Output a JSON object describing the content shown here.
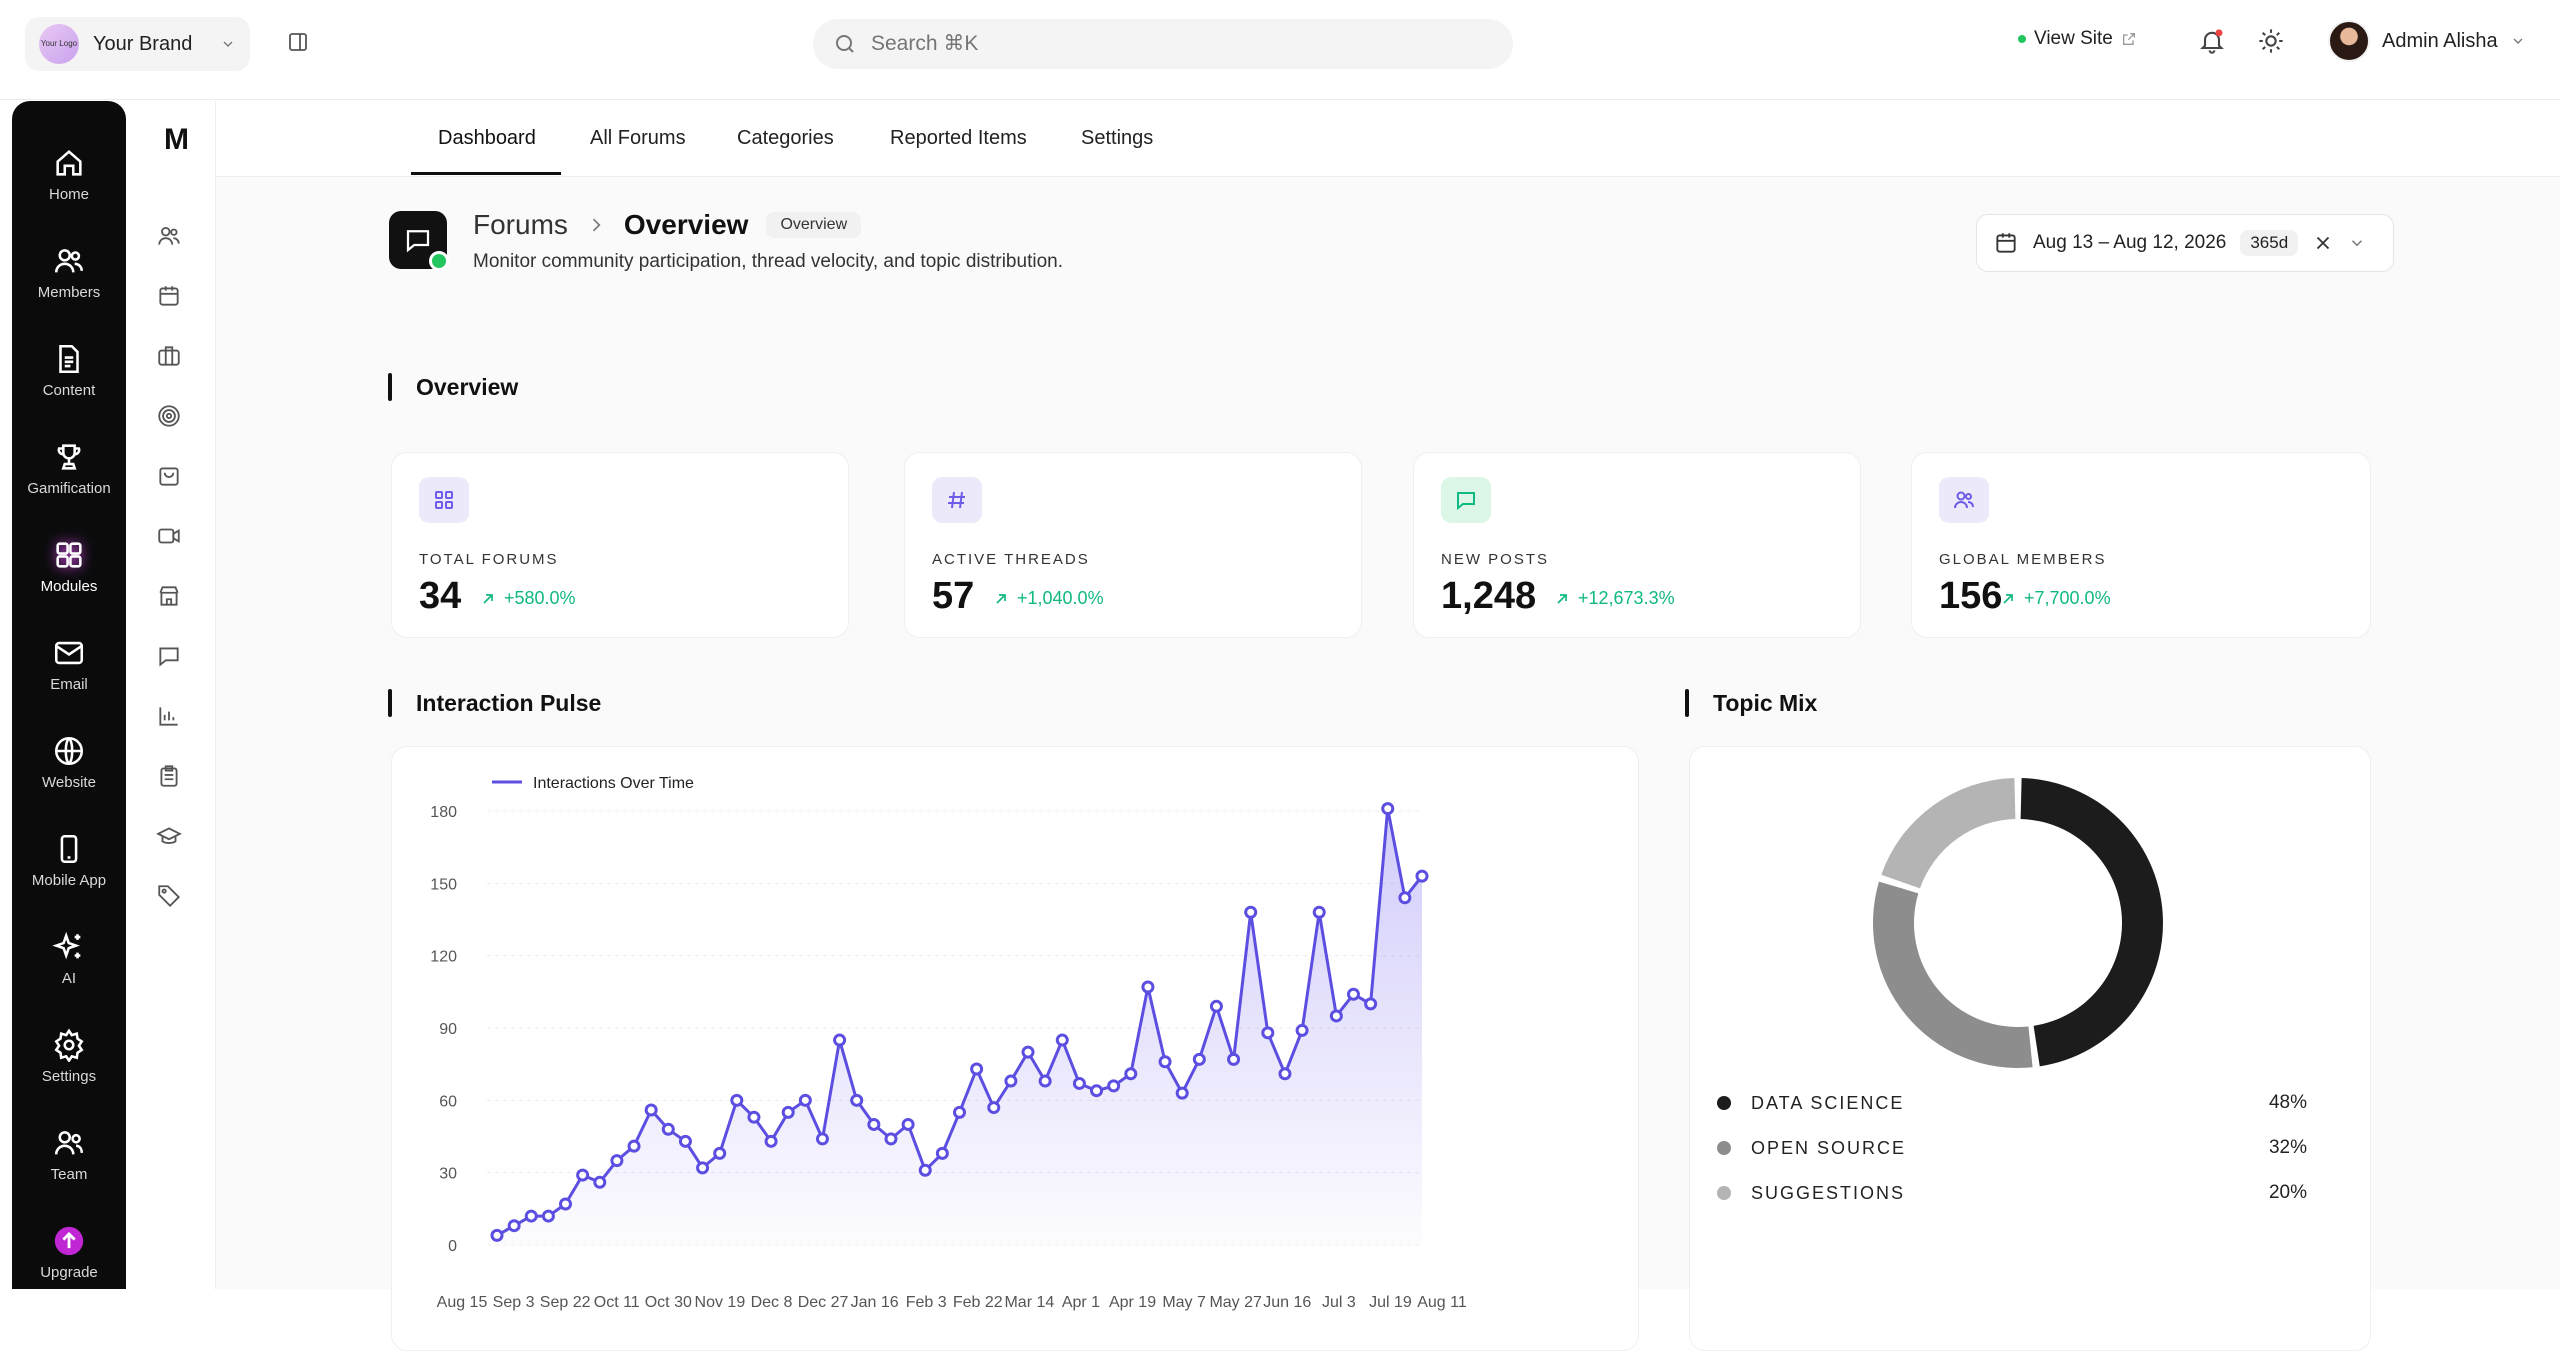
{
  "brand": {
    "logo_text": "Your Logo",
    "name": "Your Brand"
  },
  "search": {
    "placeholder": "Search ⌘K"
  },
  "header": {
    "view_site": "View Site",
    "user_name": "Admin Alisha"
  },
  "rail": [
    {
      "label": "Home",
      "icon": "home-icon"
    },
    {
      "label": "Members",
      "icon": "users-icon"
    },
    {
      "label": "Content",
      "icon": "document-icon"
    },
    {
      "label": "Gamification",
      "icon": "trophy-icon"
    },
    {
      "label": "Modules",
      "icon": "modules-icon",
      "active": true
    },
    {
      "label": "Email",
      "icon": "mail-icon"
    },
    {
      "label": "Website",
      "icon": "globe-icon"
    },
    {
      "label": "Mobile App",
      "icon": "phone-icon"
    },
    {
      "label": "AI",
      "icon": "sparkles-icon"
    },
    {
      "label": "Settings",
      "icon": "gear-icon"
    },
    {
      "label": "Team",
      "icon": "team-icon"
    },
    {
      "label": "Upgrade",
      "icon": "upgrade-icon"
    }
  ],
  "subnav": {
    "letter": "M"
  },
  "tabs": [
    {
      "label": "Dashboard",
      "active": true
    },
    {
      "label": "All Forums"
    },
    {
      "label": "Categories"
    },
    {
      "label": "Reported Items"
    },
    {
      "label": "Settings"
    }
  ],
  "page": {
    "crumb_parent": "Forums",
    "crumb_current": "Overview",
    "badge": "Overview",
    "subtitle": "Monitor community participation, thread velocity, and topic distribution."
  },
  "date_range": {
    "label": "Aug 13 – Aug 12, 2026",
    "days": "365d"
  },
  "sections": {
    "overview": "Overview",
    "pulse": "Interaction Pulse",
    "topics": "Topic Mix"
  },
  "stats": [
    {
      "label": "TOTAL FORUMS",
      "value": "34",
      "delta": "+580.0%",
      "icon": "grid-icon",
      "color": "#ece9fb"
    },
    {
      "label": "ACTIVE THREADS",
      "value": "57",
      "delta": "+1,040.0%",
      "icon": "hash-icon",
      "color": "#ece9fb"
    },
    {
      "label": "NEW POSTS",
      "value": "1,248",
      "delta": "+12,673.3%",
      "icon": "chat-icon",
      "color": "#dcf7e8"
    },
    {
      "label": "GLOBAL MEMBERS",
      "value": "156",
      "delta": "+7,700.0%",
      "icon": "users-icon",
      "color": "#ece9fb"
    }
  ],
  "colors": {
    "accent": "#6d5ce7",
    "success": "#10b981"
  },
  "chart_data": [
    {
      "type": "area",
      "title": "",
      "series": [
        {
          "name": "Interactions Over Time",
          "values": [
            4,
            8,
            12,
            12,
            17,
            29,
            26,
            35,
            41,
            56,
            48,
            43,
            32,
            38,
            60,
            53,
            43,
            55,
            60,
            44,
            85,
            60,
            50,
            44,
            50,
            31,
            38,
            55,
            73,
            57,
            68,
            80,
            68,
            85,
            67,
            64,
            66,
            71,
            107,
            76,
            63,
            77,
            99,
            77,
            138,
            88,
            71,
            89,
            138,
            95,
            104,
            100,
            181,
            144,
            153
          ]
        }
      ],
      "x_ticks": [
        "Aug 15",
        "Sep 3",
        "Sep 22",
        "Oct 11",
        "Oct 30",
        "Nov 19",
        "Dec 8",
        "Dec 27",
        "Jan 16",
        "Feb 3",
        "Feb 22",
        "Mar 14",
        "Apr 1",
        "Apr 19",
        "May 7",
        "May 27",
        "Jun 16",
        "Jul 3",
        "Jul 19",
        "Aug 11"
      ],
      "y_ticks": [
        0,
        30,
        60,
        90,
        120,
        150,
        180
      ],
      "ylim": [
        0,
        180
      ],
      "legend": "top-left"
    },
    {
      "type": "pie",
      "title": "",
      "categories": [
        "DATA SCIENCE",
        "OPEN SOURCE",
        "SUGGESTIONS"
      ],
      "values": [
        48,
        32,
        20
      ],
      "labels": [
        "48%",
        "32%",
        "20%"
      ],
      "colors": [
        "#1c1c1c",
        "#8d8d8d",
        "#b4b4b4"
      ]
    }
  ]
}
